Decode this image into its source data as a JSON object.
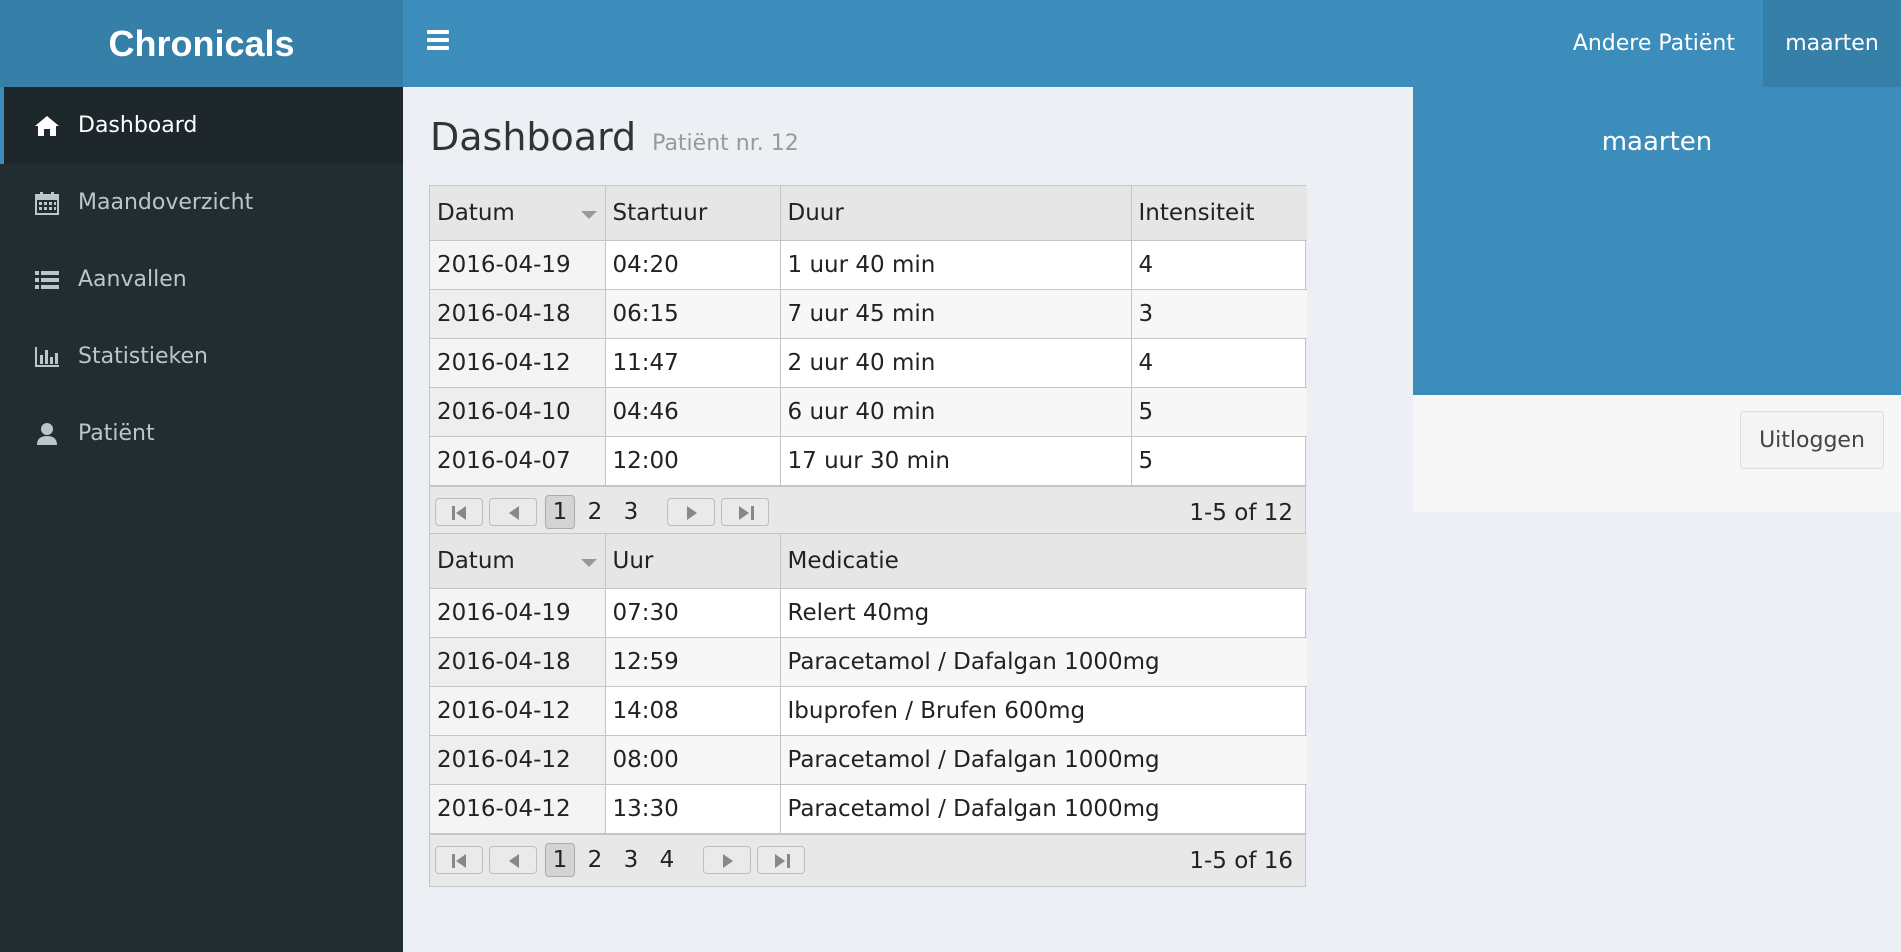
{
  "app": {
    "title": "Chronicals"
  },
  "topbar": {
    "other_patient": "Andere Patiënt",
    "user": "maarten"
  },
  "sidebar": {
    "items": [
      {
        "label": "Dashboard",
        "icon": "home-icon",
        "active": true
      },
      {
        "label": "Maandoverzicht",
        "icon": "calendar-icon",
        "active": false
      },
      {
        "label": "Aanvallen",
        "icon": "list-icon",
        "active": false
      },
      {
        "label": "Statistieken",
        "icon": "bar-chart-icon",
        "active": false
      },
      {
        "label": "Patiënt",
        "icon": "user-icon",
        "active": false
      }
    ]
  },
  "page": {
    "title": "Dashboard",
    "subtitle": "Patiënt nr. 12"
  },
  "attacks": {
    "columns": [
      "Datum",
      "Startuur",
      "Duur",
      "Intensiteit"
    ],
    "rows": [
      [
        "2016-04-19",
        "04:20",
        "1 uur 40 min",
        "4"
      ],
      [
        "2016-04-18",
        "06:15",
        "7 uur 45 min",
        "3"
      ],
      [
        "2016-04-12",
        "11:47",
        "2 uur 40 min",
        "4"
      ],
      [
        "2016-04-10",
        "04:46",
        "6 uur 40 min",
        "5"
      ],
      [
        "2016-04-07",
        "12:00",
        "17 uur 30 min",
        "5"
      ]
    ],
    "pages": [
      "1",
      "2",
      "3"
    ],
    "current_page": "1",
    "info": "1-5 of 12"
  },
  "medication": {
    "columns": [
      "Datum",
      "Uur",
      "Medicatie"
    ],
    "rows": [
      [
        "2016-04-19",
        "07:30",
        "Relert 40mg"
      ],
      [
        "2016-04-18",
        "12:59",
        "Paracetamol / Dafalgan 1000mg"
      ],
      [
        "2016-04-12",
        "14:08",
        "Ibuprofen / Brufen 600mg"
      ],
      [
        "2016-04-12",
        "08:00",
        "Paracetamol / Dafalgan 1000mg"
      ],
      [
        "2016-04-12",
        "13:30",
        "Paracetamol / Dafalgan 1000mg"
      ]
    ],
    "pages": [
      "1",
      "2",
      "3",
      "4"
    ],
    "current_page": "1",
    "info": "1-5 of 16"
  },
  "user_panel": {
    "name": "maarten",
    "logout_label": "Uitloggen"
  },
  "colors": {
    "primary": "#3c8dbc",
    "primary_dark": "#367fa9",
    "sidebar": "#222d32"
  }
}
